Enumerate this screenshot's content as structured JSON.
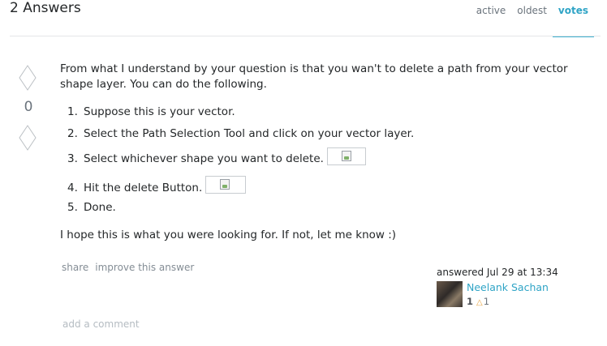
{
  "header": {
    "answers_title": "2 Answers",
    "tabs": [
      {
        "label": "active"
      },
      {
        "label": "oldest"
      },
      {
        "label": "votes"
      }
    ]
  },
  "vote": {
    "count": "0"
  },
  "answer": {
    "intro": "From what I understand by your question is that you wan't to delete a path from your vector shape layer. You can do the following.",
    "steps": [
      {
        "num": "1.",
        "text": "Suppose this is your vector."
      },
      {
        "num": "2.",
        "text": "Select the Path Selection Tool and click on your vector layer."
      },
      {
        "num": "3.",
        "text": "Select whichever shape you want to delete."
      },
      {
        "num": "4.",
        "text": "Hit the delete Button."
      },
      {
        "num": "5.",
        "text": "Done."
      }
    ],
    "outro": "I hope this is what you were looking for. If not, let me know :)"
  },
  "menu": {
    "share": "share",
    "improve": "improve this answer"
  },
  "user": {
    "action": "answered Jul 29 at 13:34",
    "name": "Neelank Sachan",
    "reputation": "1",
    "bronze_badges": "1"
  },
  "comments": {
    "add_label": "add a comment"
  }
}
